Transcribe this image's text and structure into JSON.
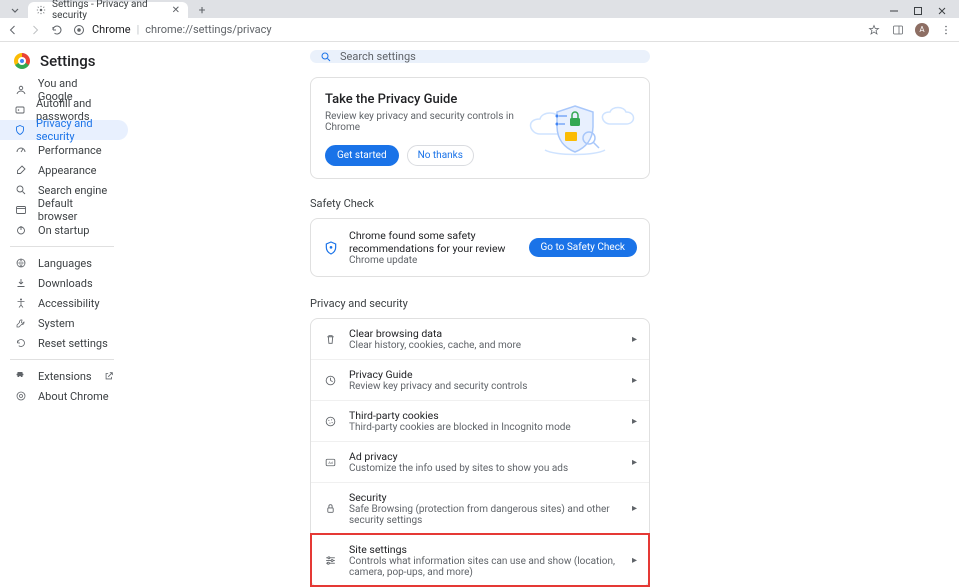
{
  "window": {
    "tab_title": "Settings - Privacy and security"
  },
  "omnibox": {
    "host_label": "Chrome",
    "url": "chrome://settings/privacy"
  },
  "settings_title": "Settings",
  "nav": {
    "items": [
      {
        "id": "you",
        "label": "You and Google"
      },
      {
        "id": "autofill",
        "label": "Autofill and passwords"
      },
      {
        "id": "privacy",
        "label": "Privacy and security",
        "active": true
      },
      {
        "id": "perf",
        "label": "Performance"
      },
      {
        "id": "appearance",
        "label": "Appearance"
      },
      {
        "id": "search",
        "label": "Search engine"
      },
      {
        "id": "default",
        "label": "Default browser"
      },
      {
        "id": "startup",
        "label": "On startup"
      }
    ],
    "group2": [
      {
        "id": "languages",
        "label": "Languages"
      },
      {
        "id": "downloads",
        "label": "Downloads"
      },
      {
        "id": "accessibility",
        "label": "Accessibility"
      },
      {
        "id": "system",
        "label": "System"
      },
      {
        "id": "reset",
        "label": "Reset settings"
      }
    ],
    "group3": [
      {
        "id": "extensions",
        "label": "Extensions"
      },
      {
        "id": "about",
        "label": "About Chrome"
      }
    ]
  },
  "search": {
    "placeholder": "Search settings"
  },
  "guide": {
    "title": "Take the Privacy Guide",
    "subtitle": "Review key privacy and security controls in Chrome",
    "get_started": "Get started",
    "no_thanks": "No thanks"
  },
  "safety": {
    "section_label": "Safety Check",
    "main": "Chrome found some safety recommendations for your review",
    "sub": "Chrome update",
    "button": "Go to Safety Check"
  },
  "privacy_section": {
    "label": "Privacy and security",
    "rows": [
      {
        "id": "clear",
        "title": "Clear browsing data",
        "sub": "Clear history, cookies, cache, and more"
      },
      {
        "id": "guide",
        "title": "Privacy Guide",
        "sub": "Review key privacy and security controls"
      },
      {
        "id": "cookies",
        "title": "Third-party cookies",
        "sub": "Third-party cookies are blocked in Incognito mode"
      },
      {
        "id": "ads",
        "title": "Ad privacy",
        "sub": "Customize the info used by sites to show you ads"
      },
      {
        "id": "security",
        "title": "Security",
        "sub": "Safe Browsing (protection from dangerous sites) and other security settings"
      },
      {
        "id": "sites",
        "title": "Site settings",
        "sub": "Controls what information sites can use and show (location, camera, pop-ups, and more)"
      }
    ]
  }
}
